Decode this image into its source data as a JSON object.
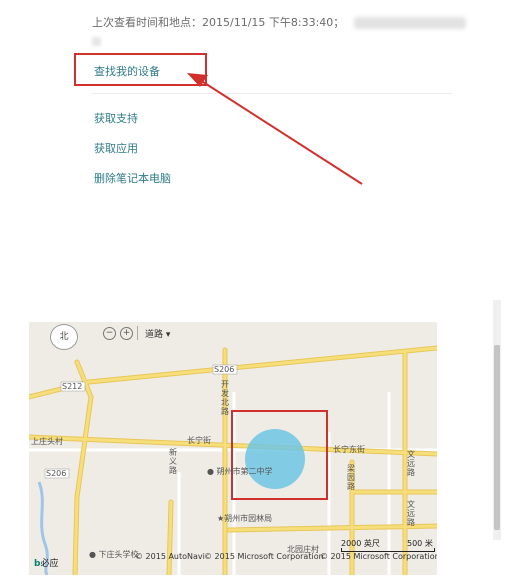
{
  "account": {
    "last_seen_label": "上次查看时间和地点：",
    "last_seen_value": "2015/11/15 下午8:33:40；"
  },
  "links": {
    "find_device": "查找我的设备",
    "get_support": "获取支持",
    "get_apps": "获取应用",
    "remove_laptop": "删除笔记本电脑"
  },
  "map": {
    "nav": {
      "compass_label": "北"
    },
    "toolbar": {
      "style_label": "道路 ▾"
    },
    "labels": {
      "s206_top": "S206",
      "s212": "S212",
      "s206_left": "S206",
      "kaifa": "开发北路",
      "changning_w": "长宁街",
      "changning_e": "长宁东街",
      "shangzhuang": "上庄头村",
      "wenyuan": "文远路",
      "xinyi": "新义路",
      "liangyuan": "梁园路",
      "wenyuan2": "文远路",
      "school": "朔州市第二中学",
      "forestry": "朔州市园林局",
      "primary": "下庄头学校",
      "beiyuan": "北园庄村"
    },
    "scale": {
      "imperial": "2000 英尺",
      "metric": "500 米"
    },
    "copyrights": [
      "© 2015 AutoNavi",
      "© 2015 Microsoft Corporation",
      "© 2015 Microsoft Corporation"
    ],
    "brand": "必应",
    "accent": "#6ec6e3"
  },
  "colors": {
    "link": "#2f7c8b",
    "annotation": "#d0312d",
    "road_major": "#f6df7a",
    "road_edge": "#e8c65a",
    "map_bg": "#efece6"
  }
}
